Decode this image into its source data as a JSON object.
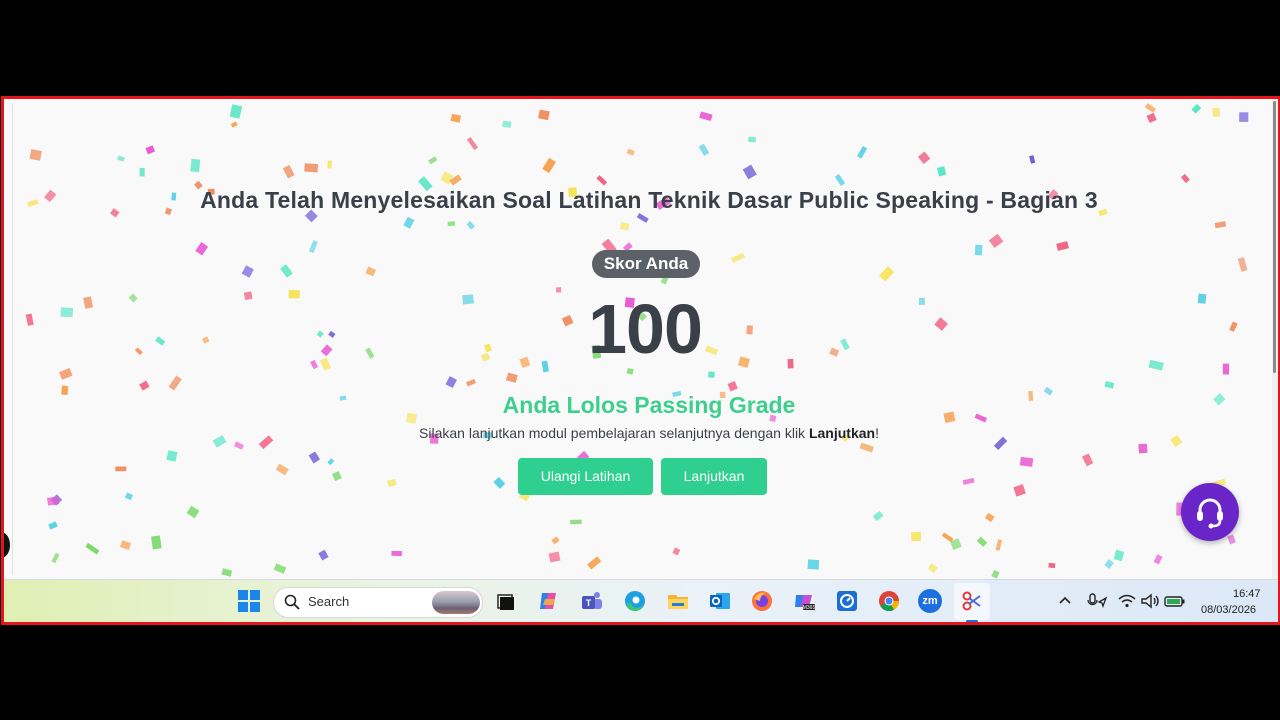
{
  "quiz": {
    "title": "Anda Telah Menyelesaikan Soal Latihan Teknik Dasar Public Speaking - Bagian 3",
    "score_label": "Skor Anda",
    "score": "100",
    "result": "Anda Lolos Passing Grade",
    "message_prefix": "Silakan lanjutkan modul pembelajaran selanjutnya dengan klik ",
    "message_bold": "Lanjutkan",
    "message_suffix": "!",
    "retry_button": "Ulangi Latihan",
    "continue_button": "Lanjutkan"
  },
  "colors": {
    "accent_green": "#2ecf8f",
    "title_text": "#3b3f48",
    "support_purple": "#6a25c9",
    "frame_border": "#e8141b"
  },
  "support_widget": {
    "icon": "headset-icon"
  },
  "taskbar": {
    "search_placeholder": "Search",
    "pinned_icons": [
      "windows-start-icon",
      "task-view-icon",
      "copilot-icon",
      "teams-icon",
      "edge-icon",
      "file-explorer-icon",
      "outlook-icon",
      "firefox-icon",
      "m365-copilot-icon",
      "app-icon",
      "chrome-icon",
      "zoom-icon",
      "snipping-tool-icon"
    ],
    "zoom_label": "zm",
    "time": "16:47",
    "date": "08/03/2026"
  }
}
